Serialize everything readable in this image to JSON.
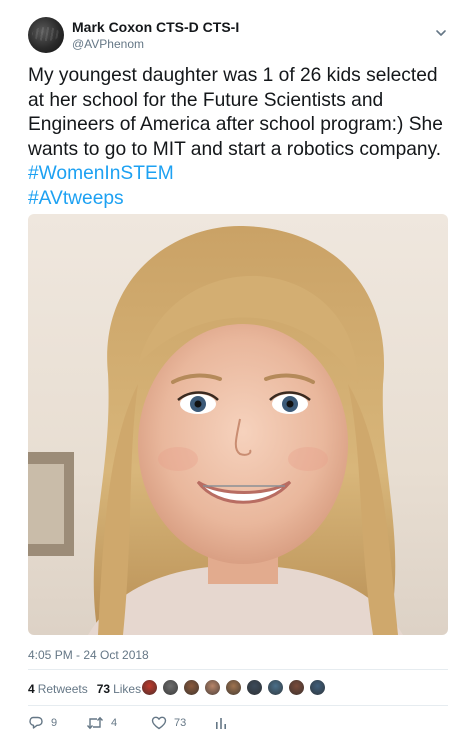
{
  "author": {
    "name": "Mark Coxon CTS-D CTS-I",
    "handle": "@AVPhenom"
  },
  "tweet": {
    "text": "My youngest daughter was 1 of 26 kids selected at her school for the Future Scientists and Engineers of America after school program:) She wants to go to MIT and start a robotics company.",
    "hashtags": [
      "#WomenInSTEM",
      "#AVtweeps"
    ],
    "timestamp": "4:05 PM - 24 Oct 2018"
  },
  "stats": {
    "retweets_count": "4",
    "retweets_label": "Retweets",
    "likes_count": "73",
    "likes_label": "Likes"
  },
  "liker_colors": [
    "#c0392b",
    "#6d6d6d",
    "#8b5a3c",
    "#b9866a",
    "#a0744f",
    "#3c4a5a",
    "#4a6f8a",
    "#7a4b3a",
    "#3f5e7a"
  ],
  "actions": {
    "replies": "9",
    "retweets": "4",
    "likes": "73"
  },
  "colors": {
    "accent": "#1da1f2",
    "muted": "#657786",
    "text": "#14171a"
  }
}
